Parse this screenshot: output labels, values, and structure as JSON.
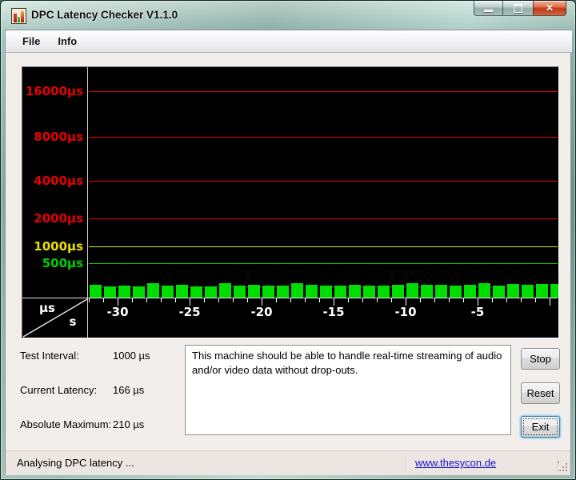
{
  "window": {
    "title": "DPC Latency Checker V1.1.0",
    "controls": {
      "minimize": "minimize",
      "maximize": "maximize",
      "close": "close"
    }
  },
  "menu": {
    "items": [
      {
        "label": "File"
      },
      {
        "label": "Info"
      }
    ]
  },
  "chart_data": {
    "type": "bar",
    "description": "DPC latency in microseconds over the last seconds",
    "y_unit": "µs",
    "x_unit": "s",
    "y_gridlines": [
      {
        "label": "16000µs",
        "value": 16000,
        "color": "#e60000"
      },
      {
        "label": "8000µs",
        "value": 8000,
        "color": "#e60000"
      },
      {
        "label": "4000µs",
        "value": 4000,
        "color": "#e60000"
      },
      {
        "label": "2000µs",
        "value": 2000,
        "color": "#e60000"
      },
      {
        "label": "1000µs",
        "value": 1000,
        "color": "#e8e000"
      },
      {
        "label": "500µs",
        "value": 500,
        "color": "#00d000"
      }
    ],
    "x_tick_labels": [
      "-30",
      "-25",
      "-20",
      "-15",
      "-10",
      "-5"
    ],
    "x_range_seconds": [
      -32,
      0
    ],
    "bar_color": "#00dd00",
    "values_us": [
      185,
      165,
      170,
      162,
      205,
      175,
      186,
      168,
      163,
      214,
      178,
      184,
      176,
      171,
      210,
      186,
      179,
      174,
      188,
      170,
      176,
      181,
      214,
      181,
      187,
      177,
      182,
      211,
      176,
      201,
      186,
      201,
      196
    ]
  },
  "stats": {
    "rows": [
      {
        "label": "Test Interval:",
        "value": "1000 µs"
      },
      {
        "label": "Current Latency:",
        "value": "166 µs"
      },
      {
        "label": "Absolute Maximum:",
        "value": "210 µs"
      }
    ]
  },
  "message": "This machine should be able to handle real-time streaming of audio and/or video data without drop-outs.",
  "buttons": {
    "stop": "Stop",
    "reset": "Reset",
    "exit": "Exit"
  },
  "statusbar": {
    "text": "Analysing DPC latency ...",
    "link": "www.thesycon.de"
  }
}
